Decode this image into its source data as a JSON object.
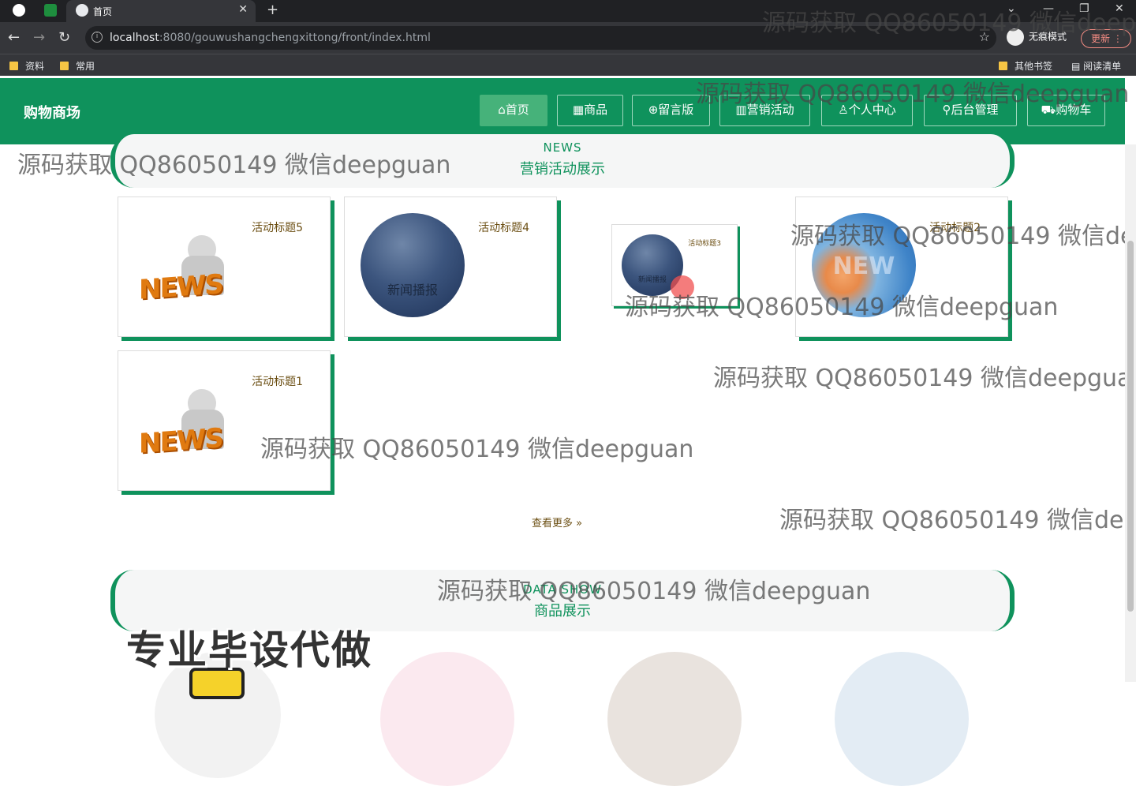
{
  "browser": {
    "tab_title": "首页",
    "url_host": "localhost",
    "url_path": ":8080/gouwushangchengxittong/front/index.html",
    "incognito_label": "无痕模式",
    "update_label": "更新",
    "bookmarks": [
      "资料",
      "常用"
    ],
    "bookmarks_right": [
      "其他书签",
      "阅读清单"
    ]
  },
  "header": {
    "title": "购物商场",
    "nav": [
      {
        "label": "首页",
        "icon": "home-icon"
      },
      {
        "label": "商品",
        "icon": "goods-icon"
      },
      {
        "label": "留言版",
        "icon": "globe-icon"
      },
      {
        "label": "营销活动",
        "icon": "activity-icon"
      },
      {
        "label": "个人中心",
        "icon": "user-icon"
      },
      {
        "label": "后台管理",
        "icon": "link-icon"
      },
      {
        "label": "购物车",
        "icon": "cart-icon"
      }
    ],
    "active_index": 0
  },
  "news_section": {
    "en": "NEWS",
    "cn": "营销活动展示",
    "cards": [
      {
        "title": "活动标题5",
        "image": "news-figure"
      },
      {
        "title": "活动标题4",
        "image": "news-broadcast",
        "image_text": "新闻播报"
      },
      {
        "title": "活动标题3",
        "image": "news-broadcast",
        "image_text": "新闻播报"
      },
      {
        "title": "活动标题2",
        "image": "news-globe",
        "image_text": "NEW"
      },
      {
        "title": "活动标题1",
        "image": "news-figure"
      }
    ],
    "news_word": "NEWS",
    "more": "查看更多 »"
  },
  "product_section": {
    "en": "DATA SHOW",
    "cn": "商品展示"
  },
  "ad_text": "专业毕设代做",
  "watermark": "源码获取 QQ86050149 微信deepguan",
  "colors": {
    "brand": "#0f925c",
    "title": "#6b4e12"
  }
}
